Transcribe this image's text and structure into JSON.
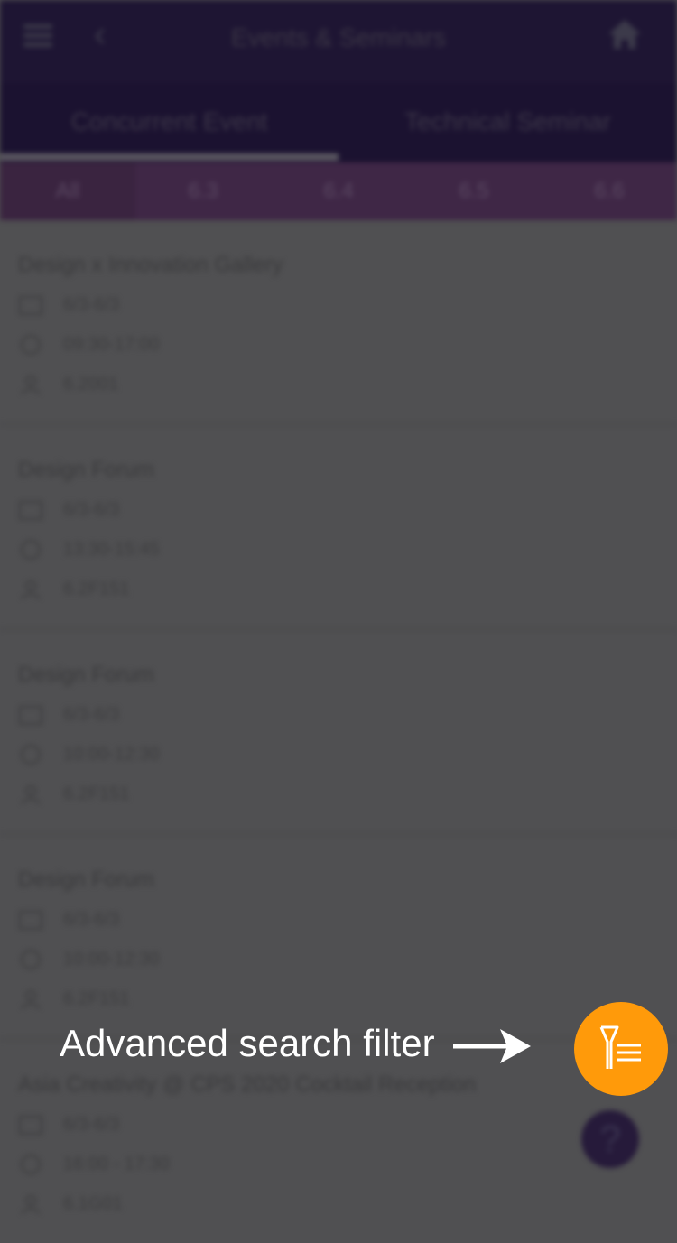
{
  "header": {
    "title": "Events & Seminars",
    "menu_icon": "hamburger-menu-icon",
    "back_icon": "chevron-left-icon",
    "home_icon": "home-icon"
  },
  "main_tabs": [
    {
      "label": "Concurrent Event",
      "active": true
    },
    {
      "label": "Technical Seminar",
      "active": false
    }
  ],
  "date_tabs": [
    {
      "label": "All",
      "active": true
    },
    {
      "label": "6.3"
    },
    {
      "label": "6.4"
    },
    {
      "label": "6.5"
    },
    {
      "label": "6.6"
    }
  ],
  "events": [
    {
      "name": "Design x Innovation Gallery",
      "date": "6/3-6/3",
      "time": "09:30-17:00",
      "location": "6.2001"
    },
    {
      "name": "Design Forum",
      "date": "6/3-6/3",
      "time": "13:30-15:45",
      "location": "6.2F151"
    },
    {
      "name": "Design Forum",
      "date": "6/3-6/3",
      "time": "10:00-12:30",
      "location": "6.2F151"
    },
    {
      "name": "Design Forum",
      "date": "6/3-6/3",
      "time": "10:00-12:30",
      "location": "6.2F151"
    },
    {
      "name": "Asia Creativity @ CPS 2020 Cocktail Reception",
      "date": "6/3-6/3",
      "time": "16:00 - 17:30",
      "location": "6.1G01"
    }
  ],
  "overlay": {
    "label": "Advanced search filter",
    "fab_icon": "filter-list-icon",
    "fab_color": "#ff9a0a"
  },
  "help": {
    "label": "?"
  }
}
